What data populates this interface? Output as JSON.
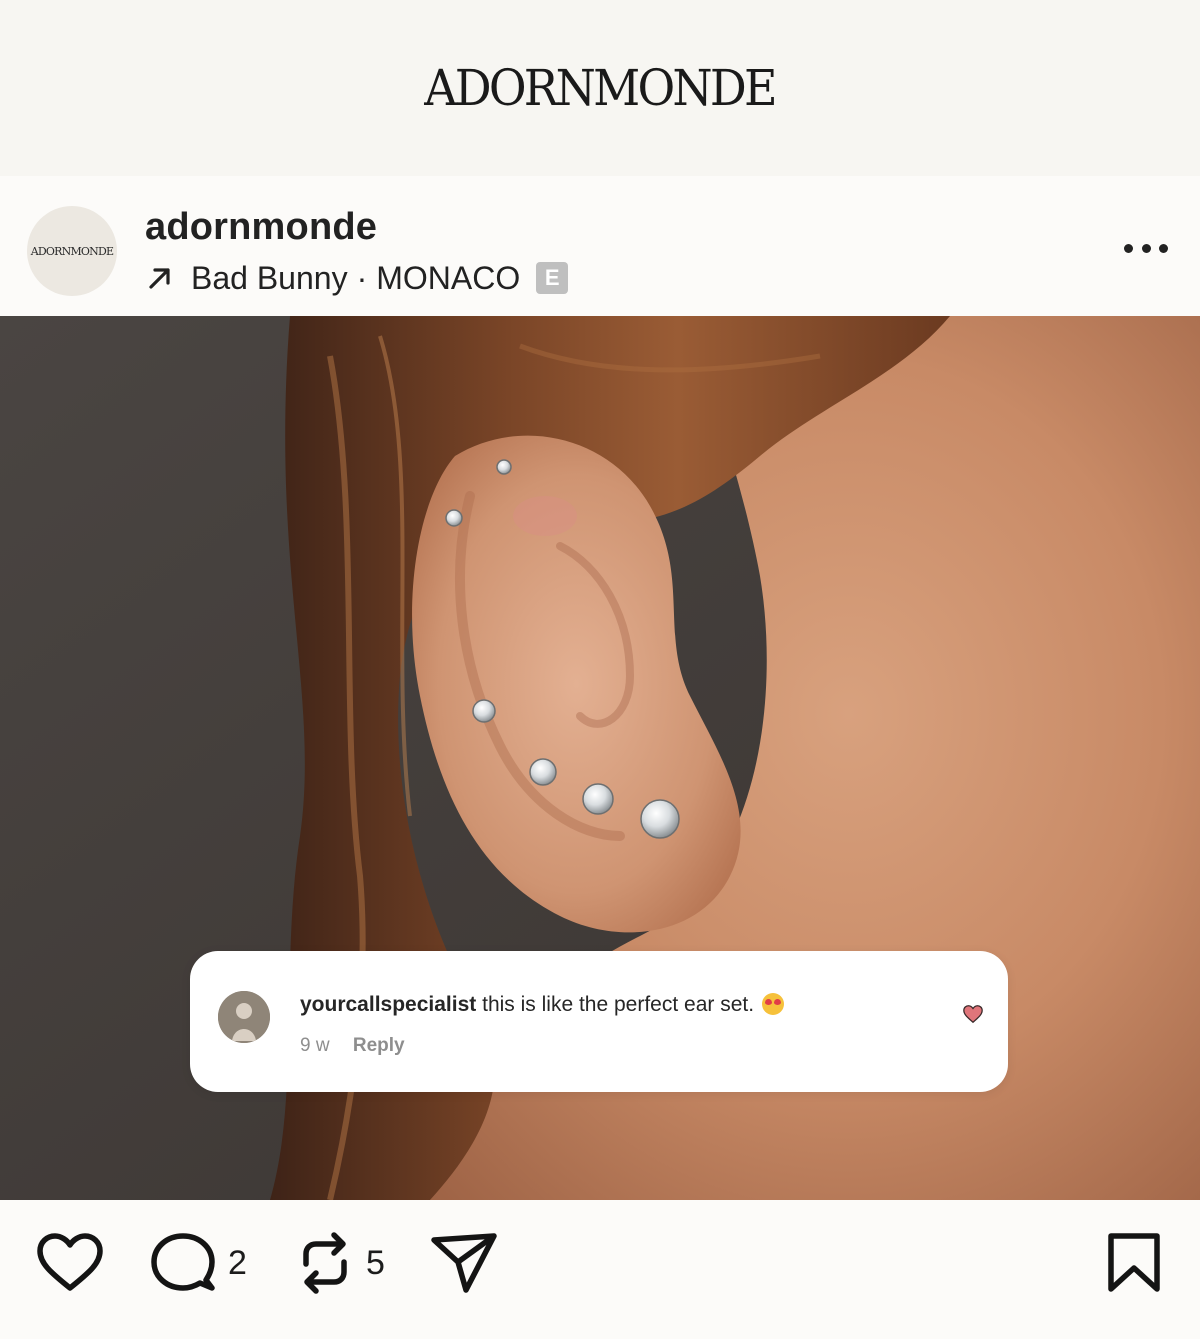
{
  "brand": {
    "logo_text": "ADORNMONDE"
  },
  "post": {
    "avatar_text": "ADORNMONDE",
    "username": "adornmonde",
    "music": {
      "song": "Bad Bunny",
      "separator": "·",
      "artist_tag": "MONACO",
      "explicit_badge": "E"
    },
    "more_icon": "more-horizontal-icon"
  },
  "photo": {
    "subject": "ear-with-diamond-studs-photo"
  },
  "comment": {
    "username": "yourcallspecialist",
    "text": "this is like the perfect ear set.",
    "emoji": "heart-eyes-emoji",
    "age": "9 w",
    "reply_label": "Reply",
    "like_icon": "heart-filled-icon"
  },
  "actions": {
    "like_icon": "heart-outline-icon",
    "comment_icon": "comment-bubble-icon",
    "comment_count": "2",
    "repost_icon": "repost-icon",
    "repost_count": "5",
    "share_icon": "send-icon",
    "save_icon": "bookmark-icon"
  },
  "colors": {
    "background": "#fbfaf8",
    "text": "#1c1c1c",
    "muted": "#8e8e8e",
    "like_red": "#e0757a"
  }
}
